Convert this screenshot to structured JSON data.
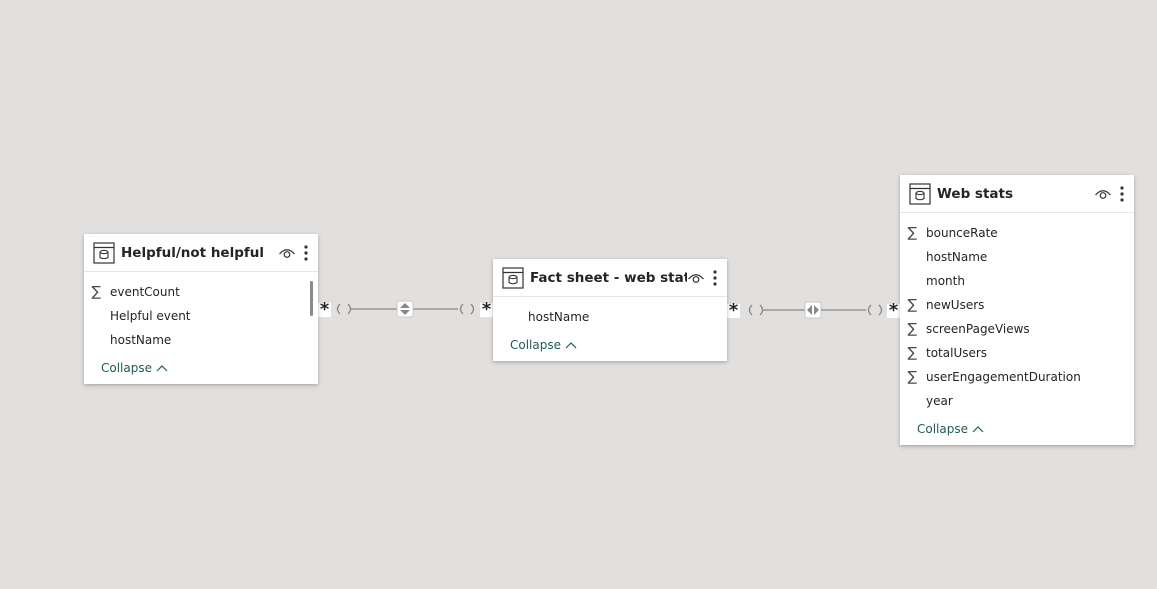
{
  "tables": [
    {
      "id": "helpful",
      "title": "Helpful/not helpful",
      "fields": [
        {
          "name": "eventCount",
          "aggregate": true
        },
        {
          "name": "Helpful event",
          "aggregate": false
        },
        {
          "name": "hostName",
          "aggregate": false
        }
      ],
      "collapse_label": "Collapse"
    },
    {
      "id": "fact",
      "title": "Fact sheet - web stats",
      "fields": [
        {
          "name": "hostName",
          "aggregate": false
        }
      ],
      "collapse_label": "Collapse"
    },
    {
      "id": "web",
      "title": "Web stats",
      "fields": [
        {
          "name": "bounceRate",
          "aggregate": true
        },
        {
          "name": "hostName",
          "aggregate": false
        },
        {
          "name": "month",
          "aggregate": false
        },
        {
          "name": "newUsers",
          "aggregate": true
        },
        {
          "name": "screenPageViews",
          "aggregate": true
        },
        {
          "name": "totalUsers",
          "aggregate": true
        },
        {
          "name": "userEngagementDuration",
          "aggregate": true
        },
        {
          "name": "year",
          "aggregate": false
        }
      ],
      "collapse_label": "Collapse"
    }
  ],
  "relationships": [
    {
      "from": "helpful",
      "to": "fact",
      "from_cardinality": "*",
      "to_cardinality": "*",
      "cross_filter": "both"
    },
    {
      "from": "fact",
      "to": "web",
      "from_cardinality": "*",
      "to_cardinality": "*",
      "cross_filter": "both"
    }
  ],
  "symbols": {
    "aggregate": "∑",
    "many": "*"
  },
  "icons": {
    "table": "table-icon",
    "visibility": "eye-icon",
    "more": "more-options-icon",
    "collapse": "chevron-up-icon"
  },
  "colors": {
    "canvas": "#e2e0de",
    "link": "#1f5c56",
    "line": "#8a8886"
  }
}
